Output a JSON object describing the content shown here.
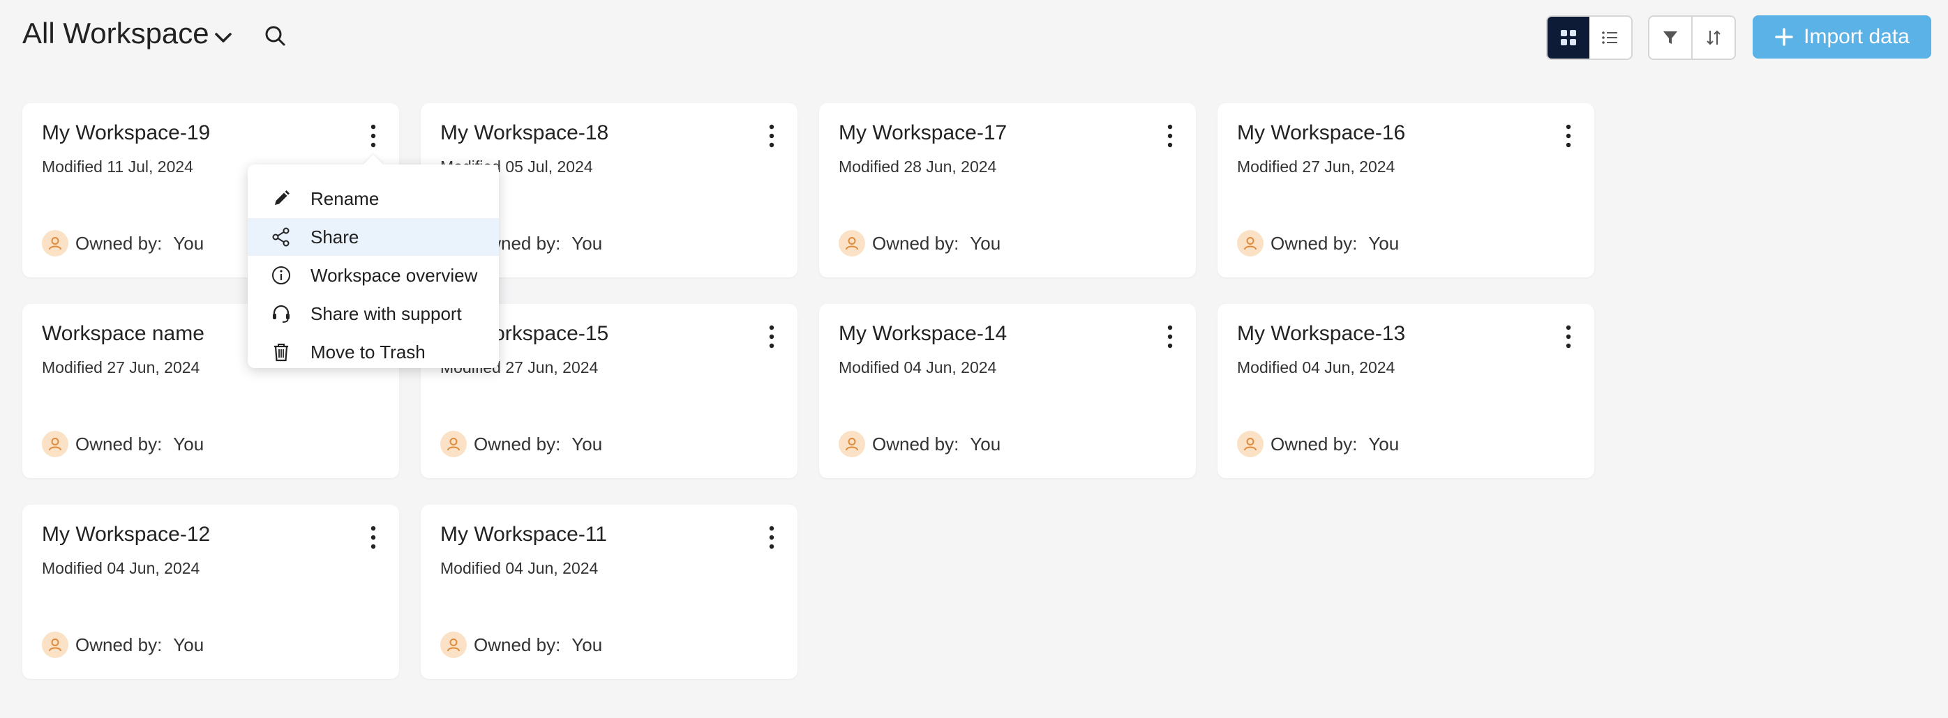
{
  "header": {
    "title": "All Workspace",
    "import_label": "Import data"
  },
  "cards": [
    {
      "title": "My Workspace-19",
      "modified": "Modified 11 Jul, 2024",
      "owner_label": "Owned by:",
      "owner": "You"
    },
    {
      "title": "My Workspace-18",
      "modified": "Modified 05 Jul, 2024",
      "owner_label": "Owned by:",
      "owner": "You"
    },
    {
      "title": "My Workspace-17",
      "modified": "Modified 28 Jun, 2024",
      "owner_label": "Owned by:",
      "owner": "You"
    },
    {
      "title": "My Workspace-16",
      "modified": "Modified 27 Jun, 2024",
      "owner_label": "Owned by:",
      "owner": "You"
    },
    {
      "title": "Workspace name",
      "modified": "Modified 27 Jun, 2024",
      "owner_label": "Owned by:",
      "owner": "You"
    },
    {
      "title": "My Workspace-15",
      "modified": "Modified 27 Jun, 2024",
      "owner_label": "Owned by:",
      "owner": "You"
    },
    {
      "title": "My Workspace-14",
      "modified": "Modified 04 Jun, 2024",
      "owner_label": "Owned by:",
      "owner": "You"
    },
    {
      "title": "My Workspace-13",
      "modified": "Modified 04 Jun, 2024",
      "owner_label": "Owned by:",
      "owner": "You"
    },
    {
      "title": "My Workspace-12",
      "modified": "Modified 04 Jun, 2024",
      "owner_label": "Owned by:",
      "owner": "You"
    },
    {
      "title": "My Workspace-11",
      "modified": "Modified 04 Jun, 2024",
      "owner_label": "Owned by:",
      "owner": "You"
    }
  ],
  "context_menu": {
    "items": [
      {
        "label": "Rename",
        "icon": "pencil-icon"
      },
      {
        "label": "Share",
        "icon": "share-icon"
      },
      {
        "label": "Workspace overview",
        "icon": "info-icon"
      },
      {
        "label": "Share with support",
        "icon": "headset-icon"
      },
      {
        "label": "Move to Trash",
        "icon": "trash-icon"
      }
    ],
    "highlighted_item": "Share"
  },
  "colors": {
    "accent": "#5ab2e6",
    "active_toggle": "#0d1b36",
    "avatar_bg": "#fbe2c6",
    "avatar_fg": "#e08a3c",
    "menu_highlight": "#eaf3fb"
  }
}
